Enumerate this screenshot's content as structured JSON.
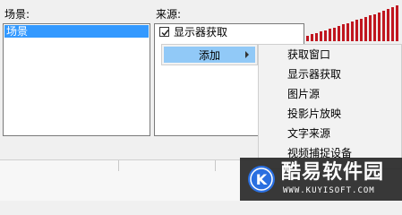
{
  "scenes": {
    "label": "场景:",
    "items": [
      "场景"
    ],
    "selected_color": "#3399ff"
  },
  "sources": {
    "label": "来源:",
    "items": [
      {
        "name": "显示器获取",
        "checked": true
      }
    ]
  },
  "context_menu": {
    "add_label": "添加",
    "highlight_color": "#91c9f7"
  },
  "submenu": {
    "items": [
      "获取窗口",
      "显示器获取",
      "图片源",
      "投影片放映",
      "文字来源",
      "视频捕捉设备"
    ]
  },
  "audio_meter": {
    "color": "#c0161f",
    "icon": "volume-meter"
  },
  "watermark": {
    "logo_letter": "K",
    "title": "酷易软件园",
    "url": "WWW.KUYISOFT.COM",
    "logo_color": "#2a6fe0"
  }
}
